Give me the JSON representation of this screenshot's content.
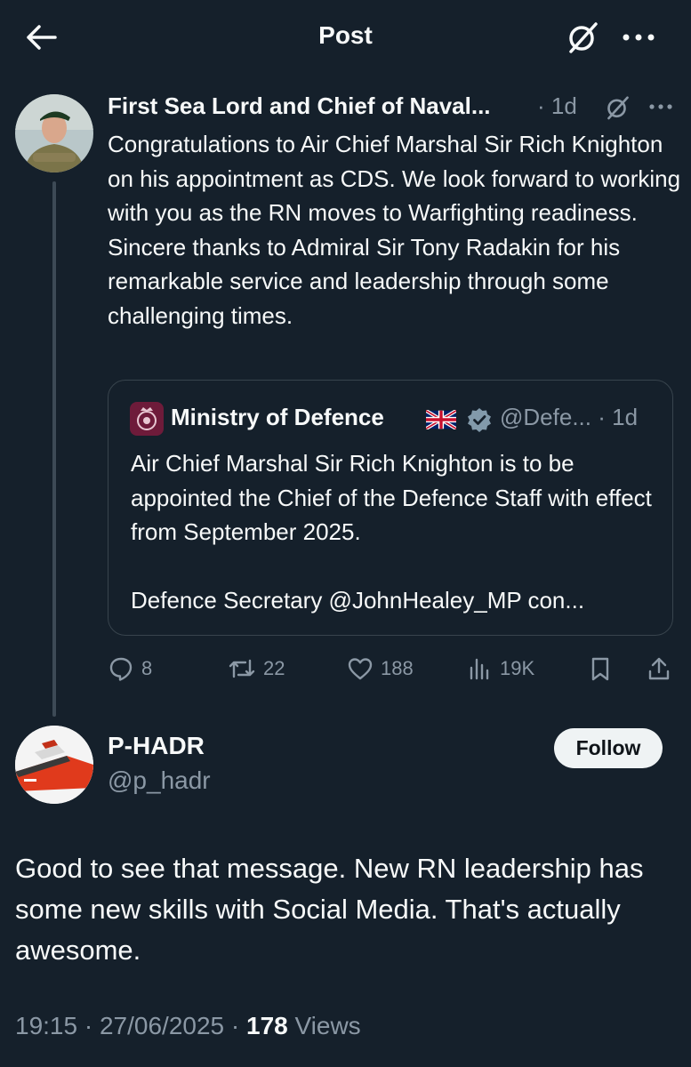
{
  "header": {
    "title": "Post",
    "back_icon": "arrow-left-icon",
    "grok_icon": "grok-icon",
    "more_icon": "more-icon"
  },
  "parent_post": {
    "author_name": "First Sea Lord and Chief of Naval...",
    "separator": "·",
    "time": "1d",
    "text": "Congratulations to Air Chief Marshal Sir Rich Knighton on his appointment as CDS.  We look forward to working with you as the RN moves to Warfighting readiness.  Sincere thanks to Admiral Sir Tony Radakin for his remarkable service and leadership through some challenging times.",
    "quote": {
      "author_name": "Ministry of Defence",
      "handle": "@Defe...",
      "separator": "·",
      "time": "1d",
      "line1": "Air Chief Marshal Sir Rich Knighton is to be appointed the Chief of the Defence Staff with effect from September 2025.",
      "line2": "Defence Secretary @JohnHealey_MP con..."
    },
    "actions": {
      "replies": "8",
      "reposts": "22",
      "likes": "188",
      "views": "19K"
    }
  },
  "reply_post": {
    "author_name": "P-HADR",
    "handle": "@p_hadr",
    "follow_label": "Follow",
    "text": "Good to see that message. New RN leadership has some new skills with Social Media. That's actually awesome.",
    "meta": {
      "time": "19:15",
      "sep1": "·",
      "date": "27/06/2025",
      "sep2": "·",
      "views_count": "178",
      "views_label": "Views"
    }
  },
  "colors": {
    "background": "#15202b",
    "text": "#f7f9f9",
    "secondary": "#8b98a5",
    "border": "#38444d"
  }
}
